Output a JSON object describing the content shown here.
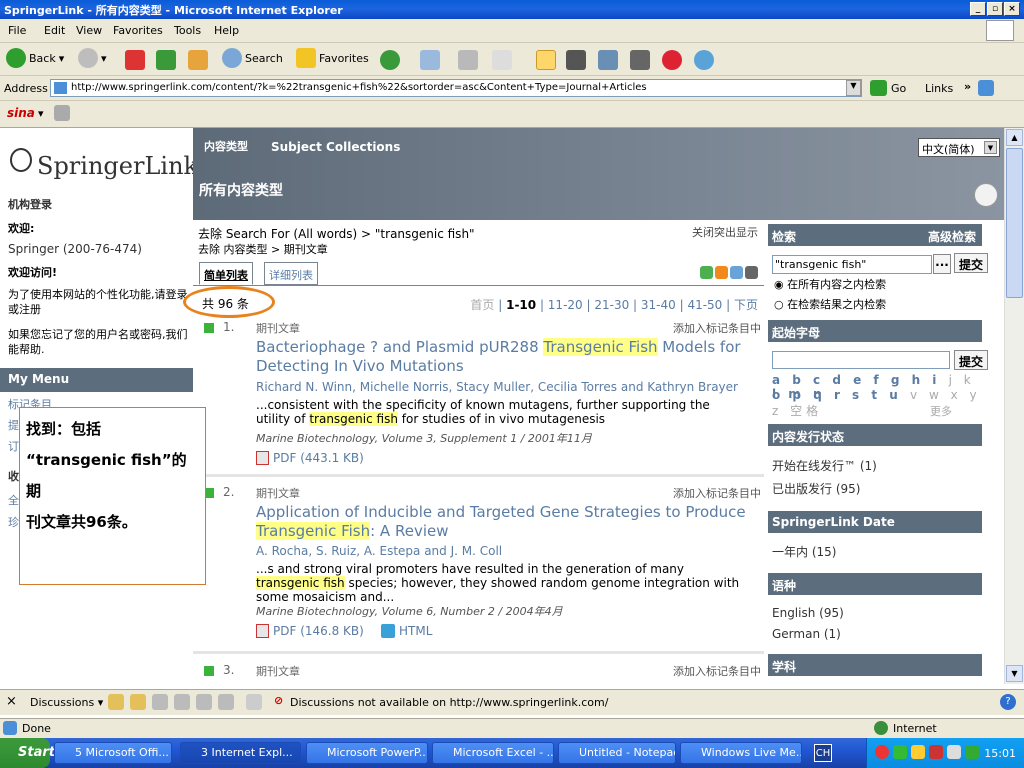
{
  "window": {
    "title": "SpringerLink - 所有内容类型 - Microsoft Internet Explorer"
  },
  "menu": [
    "File",
    "Edit",
    "View",
    "Favorites",
    "Tools",
    "Help"
  ],
  "toolbar": {
    "back": "Back",
    "search": "Search",
    "favorites": "Favorites"
  },
  "address": {
    "label": "Address",
    "url": "http://www.springerlink.com/content/?k=%22transgenic+fish%22&sortorder=asc&Content+Type=Journal+Articles",
    "go": "Go",
    "links": "Links"
  },
  "sina": {
    "label": "sina"
  },
  "left": {
    "logo": "SpringerLink",
    "inst_login": "机构登录",
    "welcome_label": "欢迎:",
    "org": "Springer (200-76-474)",
    "welcome_visit": "欢迎访问!",
    "personalize": "为了使用本网站的个性化功能,请登录或注册",
    "forgot": "如果您忘记了您的用户名或密码,我们能帮助.",
    "my_menu": "My Menu",
    "marked": "标记条目",
    "partial": [
      "提",
      "订",
      "收",
      "全",
      "珍"
    ]
  },
  "header": {
    "tab_types": "内容类型",
    "tab_collections": "Subject Collections",
    "page_title": "所有内容类型",
    "lang": "中文(简体)"
  },
  "results": {
    "crumb1": "去除 Search For (All words) > \"transgenic fish\"",
    "crumb2": "去除 内容类型 > 期刊文章",
    "close_hl": "关闭突出显示",
    "tab_simple": "简单列表",
    "tab_detail": "详细列表",
    "count": "共 96 条",
    "pager": {
      "first": "首页",
      "current": "1-10",
      "pages": [
        "11-20",
        "21-30",
        "31-40",
        "41-50"
      ],
      "next": "下页"
    },
    "items": [
      {
        "num": "1.",
        "type": "期刊文章",
        "add": "添加入标记条目中",
        "title_pre": "Bacteriophage ? and Plasmid pUR288 ",
        "title_hl": "Transgenic Fish",
        "title_post": " Models for Detecting In Vivo Mutations",
        "authors": "Richard N. Winn, Michelle Norris, Stacy Muller, Cecilia Torres and Kathryn Brayer",
        "snip_pre": "...consistent with the specificity of known mutagens, further supporting the utility of ",
        "snip_hl": "transgenic fish",
        "snip_post": " for studies of in vivo mutagenesis",
        "journal": "Marine Biotechnology, Volume 3, Supplement 1 / 2001年11月",
        "pdf": "PDF (443.1 KB)"
      },
      {
        "num": "2.",
        "type": "期刊文章",
        "add": "添加入标记条目中",
        "title_pre": "Application of Inducible and Targeted Gene Strategies to Produce ",
        "title_hl": "Transgenic Fish",
        "title_post": ": A Review",
        "authors": "A. Rocha, S. Ruiz, A. Estepa and J. M. Coll",
        "snip_pre": "...s and strong viral promoters have resulted in the generation of many ",
        "snip_hl": "transgenic fish",
        "snip_post": " species; however, they showed random genome integration with some mosaicism and...",
        "journal": "Marine Biotechnology, Volume 6, Number 2 / 2004年4月",
        "pdf": "PDF (146.8 KB)",
        "html": "HTML"
      },
      {
        "num": "3.",
        "type": "期刊文章",
        "add": "添加入标记条目中"
      }
    ]
  },
  "right": {
    "search": "检索",
    "advanced": "高级检索",
    "query": "\"transgenic fish\"",
    "submit": "提交",
    "more_btn": "...",
    "opt_all": "在所有内容之内检索",
    "opt_results": "在检索结果之内检索",
    "start_letter": "起始字母",
    "letters_row1": "a b c d e f g h i",
    "letters_row1_dim": "j k",
    "letters_row1_end": "l m n",
    "letters_row2": "o p q r s t u",
    "letters_row2_dim": "v w x y z 空格",
    "more": "更多",
    "pub_status": "内容发行状态",
    "online_first": "开始在线发行™ (1)",
    "published": "已出版发行 (95)",
    "date_head": "SpringerLink Date",
    "one_year": "一年内 (15)",
    "lang_head": "语种",
    "english": "English (95)",
    "german": "German (1)",
    "subject_head": "学科"
  },
  "annotation": {
    "line1": "找到：包括",
    "line2": "“transgenic fish”的期",
    "line3": "刊文章共96条。"
  },
  "discussions": {
    "label": "Discussions",
    "status": "Discussions not available on http://www.springerlink.com/"
  },
  "status": {
    "done": "Done",
    "zone": "Internet"
  },
  "taskbar": {
    "start": "Start",
    "tasks": [
      "5 Microsoft Offi...",
      "3 Internet Expl...",
      "Microsoft PowerP...",
      "Microsoft Excel - ...",
      "Untitled - Notepad",
      "Windows Live Me..."
    ],
    "lang": "CH",
    "clock": "15:01"
  }
}
